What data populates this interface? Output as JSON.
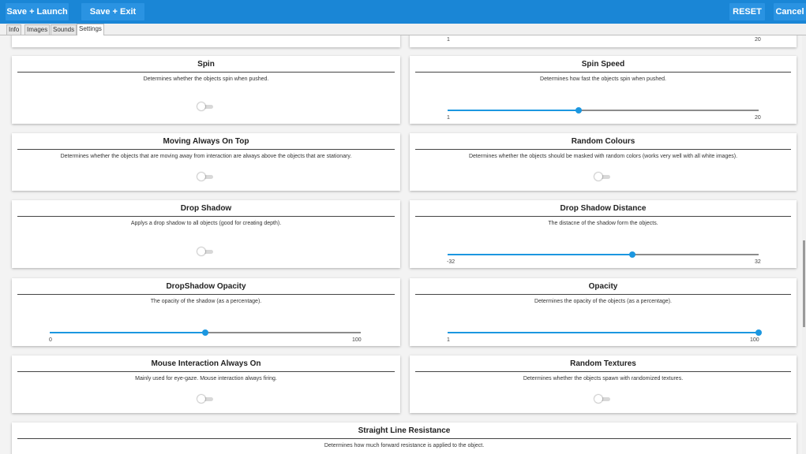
{
  "toolbar": {
    "save_launch": "Save + Launch",
    "save_exit": "Save + Exit",
    "reset": "RESET",
    "cancel": "Cancel"
  },
  "tabs": [
    "Info",
    "Images",
    "Sounds",
    "Settings"
  ],
  "active_tab": "Settings",
  "accent_color": "#1c97e0",
  "top_partial": {
    "min": "1",
    "max": "20"
  },
  "cards": {
    "spin": {
      "title": "Spin",
      "desc": "Determines whether the objects spin when pushed.",
      "on": false
    },
    "spin_speed": {
      "title": "Spin Speed",
      "desc": "Determines how fast the objects spin when pushed.",
      "min": "1",
      "max": "20",
      "value": 9
    },
    "moving_top": {
      "title": "Moving Always On Top",
      "desc": "Determines whether the objects that are moving away from interaction are always above the objects that are stationary.",
      "on": false
    },
    "random_colours": {
      "title": "Random Colours",
      "desc": "Determines whether the objects should be masked with random colors (works very well with all white images).",
      "on": false
    },
    "drop_shadow": {
      "title": "Drop Shadow",
      "desc": "Applys a drop shadow to all objects (good for creating depth).",
      "on": false
    },
    "shadow_distance": {
      "title": "Drop Shadow Distance",
      "desc": "The distacne of the shadow form the objects.",
      "min": "-32",
      "max": "32",
      "value": 6
    },
    "shadow_opacity": {
      "title": "DropShadow Opacity",
      "desc": "The opacity of the shadow (as a percentage).",
      "min": "0",
      "max": "100",
      "value": 50
    },
    "opacity": {
      "title": "Opacity",
      "desc": "Determines the opacity of the objects (as a percentage).",
      "min": "1",
      "max": "100",
      "value": 100
    },
    "mouse_interaction": {
      "title": "Mouse Interaction Always On",
      "desc": "Mainly used for eye-gaze. Mouse interaction always firing.",
      "on": false
    },
    "random_textures": {
      "title": "Random Textures",
      "desc": "Determines whether the objects spawn with randomized textures.",
      "on": false
    },
    "straight_line": {
      "title": "Straight Line Resistance",
      "desc": "Determines how much forward resistance is applied to the object."
    }
  }
}
